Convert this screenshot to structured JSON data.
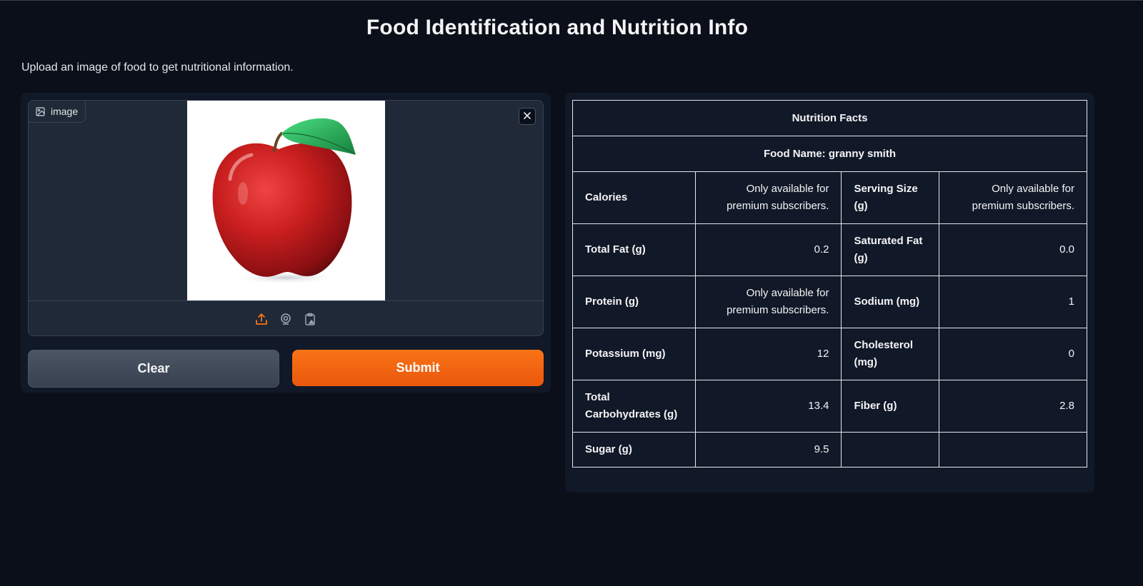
{
  "app": {
    "title": "Food Identification and Nutrition Info",
    "description": "Upload an image of food to get nutritional information."
  },
  "input": {
    "image_label": "image",
    "image_alt": "red apple with green leaf",
    "clear_label": "Clear",
    "submit_label": "Submit",
    "sources": [
      "upload-icon",
      "webcam-icon",
      "clipboard-icon"
    ]
  },
  "nutrition": {
    "heading": "Nutrition Facts",
    "food_name": "Food Name: granny smith",
    "rows": [
      {
        "l1": "Calories",
        "v1": "Only available for premium subscribers.",
        "l2": "Serving Size (g)",
        "v2": "Only available for premium subscribers."
      },
      {
        "l1": "Total Fat (g)",
        "v1": "0.2",
        "l2": "Saturated Fat (g)",
        "v2": "0.0"
      },
      {
        "l1": "Protein (g)",
        "v1": "Only available for premium subscribers.",
        "l2": "Sodium (mg)",
        "v2": "1"
      },
      {
        "l1": "Potassium (mg)",
        "v1": "12",
        "l2": "Cholesterol (mg)",
        "v2": "0"
      },
      {
        "l1": "Total Carbohydrates (g)",
        "v1": "13.4",
        "l2": "Fiber (g)",
        "v2": "2.8"
      },
      {
        "l1": "Sugar (g)",
        "v1": "9.5",
        "l2": "",
        "v2": ""
      }
    ]
  },
  "colors": {
    "background": "#0b0f19",
    "panel": "#111827",
    "accent": "#f97316",
    "button_secondary": "#4b5563"
  }
}
